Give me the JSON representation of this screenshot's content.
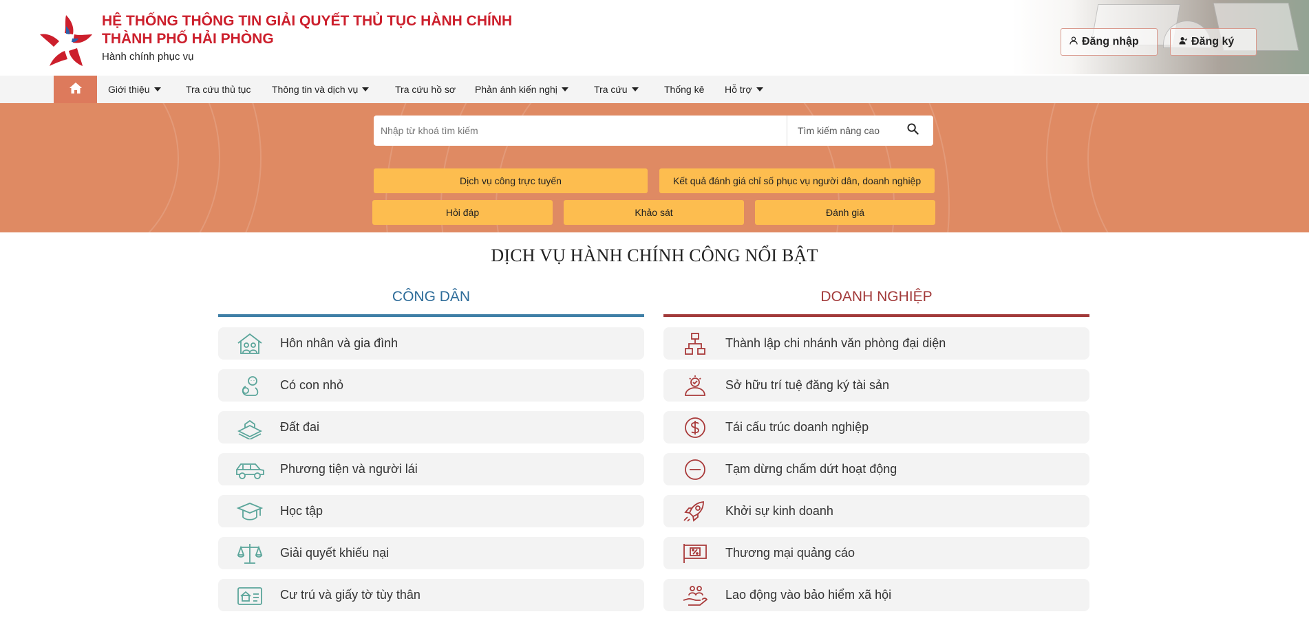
{
  "header": {
    "title_line1": "HỆ THỐNG THÔNG TIN GIẢI QUYẾT THỦ TỤC HÀNH CHÍNH",
    "title_line2": "THÀNH PHỐ HẢI PHÒNG",
    "slogan": "Hành chính phục vụ",
    "login_label": "Đăng nhập",
    "register_label": "Đăng ký",
    "brand_color": "#cc1f2c"
  },
  "nav": {
    "home_icon": "home-icon",
    "items": [
      {
        "label": "Giới thiệu",
        "dropdown": true
      },
      {
        "label": "Tra cứu thủ tục",
        "dropdown": false
      },
      {
        "label": "Thông tin và dịch vụ",
        "dropdown": true
      },
      {
        "label": "Tra cứu hồ sơ",
        "dropdown": false
      },
      {
        "label": "Phản ánh kiến nghị",
        "dropdown": true
      },
      {
        "label": "Tra cứu",
        "dropdown": true
      },
      {
        "label": "Thống kê",
        "dropdown": false
      },
      {
        "label": "Hỗ trợ",
        "dropdown": true
      }
    ]
  },
  "search": {
    "placeholder": "Nhập từ khoá tìm kiếm",
    "advanced_label": "Tìm kiếm nâng cao",
    "search_icon": "search-icon"
  },
  "quick_links": {
    "online_services": "Dịch vụ công trực tuyến",
    "evaluation_results": "Kết quả đánh giá chỉ số phục vụ người dân, doanh nghiệp",
    "qa": "Hỏi đáp",
    "survey": "Khảo sát",
    "rating": "Đánh giá"
  },
  "services": {
    "title": "DỊCH VỤ HÀNH CHÍNH CÔNG NỔI BẬT",
    "citizen": {
      "title": "CÔNG DÂN",
      "color": "#2e6c99",
      "icon_color": "#5aa59a",
      "items": [
        {
          "label": "Hôn nhân và gia đình",
          "icon": "family-house-icon"
        },
        {
          "label": "Có con nhỏ",
          "icon": "baby-icon"
        },
        {
          "label": "Đất đai",
          "icon": "land-icon"
        },
        {
          "label": "Phương tiện và người lái",
          "icon": "car-icon"
        },
        {
          "label": "Học tập",
          "icon": "graduation-cap-icon"
        },
        {
          "label": "Giải quyết khiếu nại",
          "icon": "scales-icon"
        },
        {
          "label": "Cư trú và giấy tờ tùy thân",
          "icon": "id-card-icon"
        }
      ]
    },
    "business": {
      "title": "DOANH NGHIỆP",
      "color": "#a23a3a",
      "icon_color": "#a93a3a",
      "items": [
        {
          "label": "Thành lập chi nhánh văn phòng đại diện",
          "icon": "org-chart-icon"
        },
        {
          "label": "Sở hữu trí tuệ đăng ký tài sản",
          "icon": "intellectual-property-icon"
        },
        {
          "label": "Tái cấu trúc doanh nghiệp",
          "icon": "dollar-circle-icon"
        },
        {
          "label": "Tạm dừng chấm dứt hoạt động",
          "icon": "stop-circle-icon"
        },
        {
          "label": "Khởi sự kinh doanh",
          "icon": "rocket-icon"
        },
        {
          "label": "Thương mại quảng cáo",
          "icon": "discount-sign-icon"
        },
        {
          "label": "Lao động vào bảo hiểm xã hội",
          "icon": "hand-people-icon"
        }
      ]
    }
  }
}
